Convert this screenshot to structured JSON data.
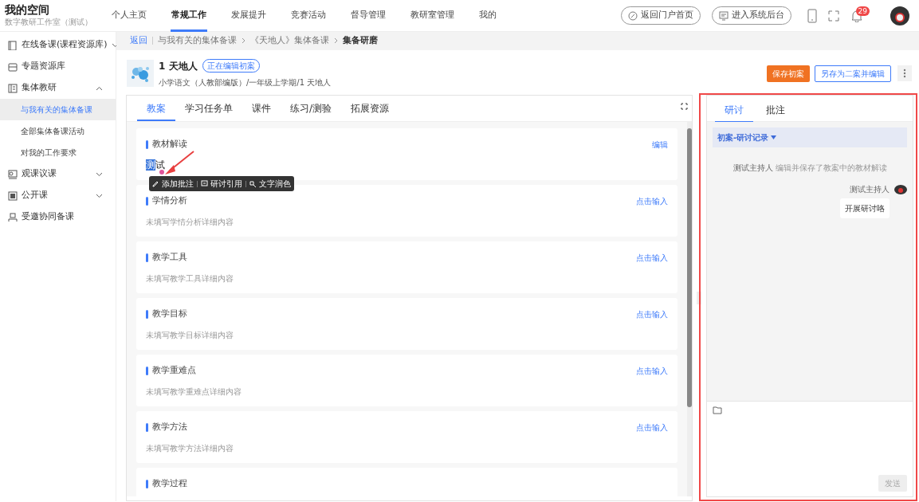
{
  "header": {
    "title": "我的空间",
    "subtitle": "数字教研工作室（测试）",
    "nav": [
      {
        "label": "个人主页",
        "selected": false
      },
      {
        "label": "常规工作",
        "selected": true
      },
      {
        "label": "发展提升",
        "selected": false
      },
      {
        "label": "竞赛活动",
        "selected": false
      },
      {
        "label": "督导管理",
        "selected": false
      },
      {
        "label": "教研室管理",
        "selected": false
      },
      {
        "label": "我的",
        "selected": false
      }
    ],
    "buttons": [
      {
        "label": "返回门户首页",
        "kind": "portal"
      },
      {
        "label": "进入系统后台",
        "kind": "admin"
      }
    ],
    "notification_count": "29"
  },
  "sidebar": {
    "items": [
      {
        "label": "在线备课(课程资源库)",
        "kind": "book",
        "expanded": false
      },
      {
        "label": "专题资源库",
        "kind": "box"
      },
      {
        "label": "集体教研",
        "kind": "list",
        "expanded": true,
        "children": [
          {
            "label": "与我有关的集体备课",
            "selected": true
          },
          {
            "label": "全部集体备课活动",
            "selected": false
          },
          {
            "label": "对我的工作要求",
            "selected": false
          }
        ]
      },
      {
        "label": "观课议课",
        "kind": "people",
        "expanded": false
      },
      {
        "label": "公开课",
        "kind": "screen",
        "expanded": false
      },
      {
        "label": "受邀协同备课",
        "kind": "group"
      }
    ]
  },
  "breadcrumb": [
    {
      "label": "返回",
      "kind": "link"
    },
    {
      "label": "与我有关的集体备课",
      "kind": "crumb"
    },
    {
      "label": "《天地人》集体备课",
      "kind": "crumb"
    },
    {
      "label": "集备研磨",
      "kind": "current"
    }
  ],
  "lesson": {
    "title": "1 天地人",
    "status": "正在编辑初案",
    "path": "小学语文（人教部编版）/一年级上学期/1 天地人"
  },
  "actions": {
    "save": "保存初案",
    "save_as": "另存为二案并编辑"
  },
  "tabs": [
    {
      "label": "教案",
      "selected": true
    },
    {
      "label": "学习任务单",
      "selected": false
    },
    {
      "label": "课件",
      "selected": false
    },
    {
      "label": "练习/测验",
      "selected": false
    },
    {
      "label": "拓展资源",
      "selected": false
    }
  ],
  "sections": [
    {
      "title": "教材解读",
      "action": "编辑",
      "content": [
        {
          "text": "测",
          "selected": true
        },
        {
          "text": "试",
          "selected": false
        }
      ]
    },
    {
      "title": "学情分析",
      "action": "点击输入",
      "placeholder": "未填写学情分析详细内容"
    },
    {
      "title": "教学工具",
      "action": "点击输入",
      "placeholder": "未填写教学工具详细内容"
    },
    {
      "title": "教学目标",
      "action": "点击输入",
      "placeholder": "未填写教学目标详细内容"
    },
    {
      "title": "教学重难点",
      "action": "点击输入",
      "placeholder": "未填写教学重难点详细内容"
    },
    {
      "title": "教学方法",
      "action": "点击输入",
      "placeholder": "未填写教学方法详细内容"
    },
    {
      "title": "教学过程"
    }
  ],
  "selection_toolbar": [
    {
      "label": "添加批注",
      "kind": "pen"
    },
    {
      "label": "研讨引用",
      "kind": "quote"
    },
    {
      "label": "文字润色",
      "kind": "polish"
    }
  ],
  "discussion": {
    "tabs": [
      {
        "label": "研讨",
        "selected": true
      },
      {
        "label": "批注",
        "selected": false
      }
    ],
    "record": "初案-研讨记录",
    "messages": [
      {
        "kind": "system",
        "author": "测试主持人",
        "text": "编辑并保存了教案中的教材解读"
      },
      {
        "kind": "chat",
        "author": "测试主持人",
        "text": "开展研讨咯"
      }
    ],
    "send": {
      "label": "发送",
      "disabled": true
    }
  }
}
